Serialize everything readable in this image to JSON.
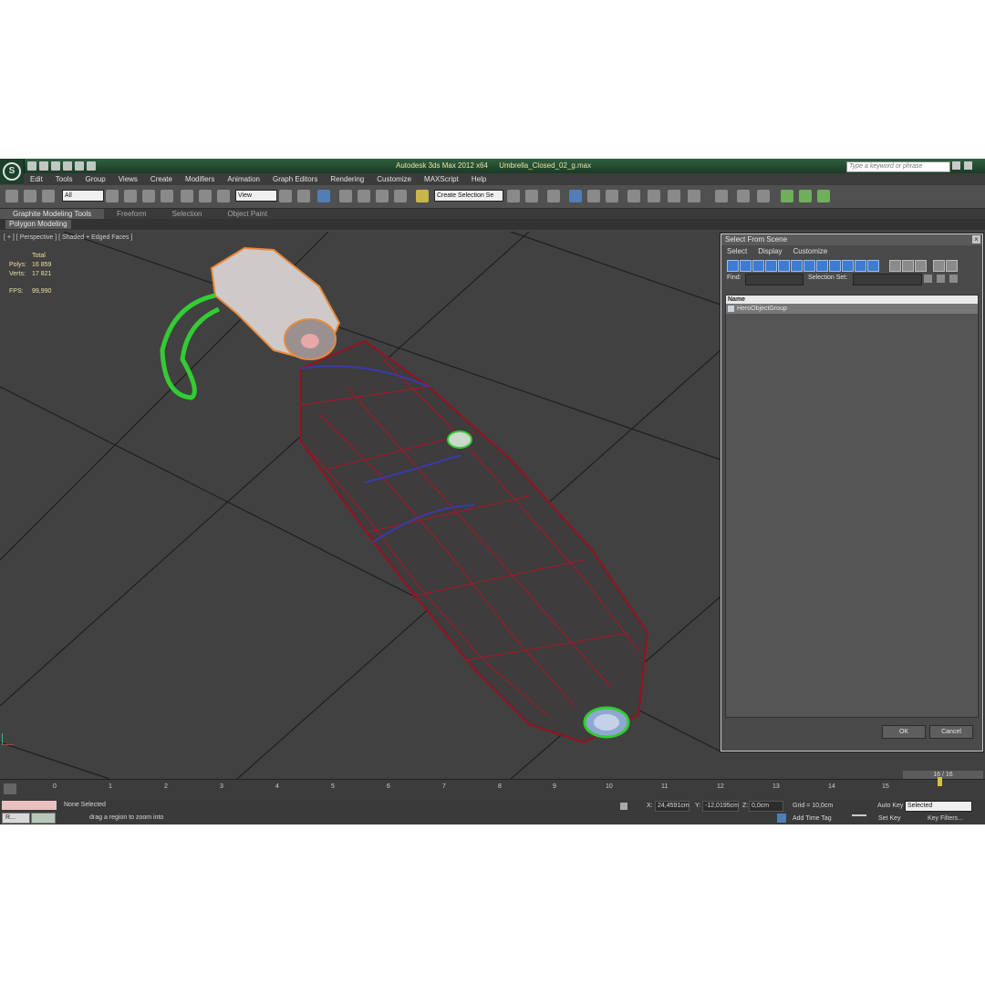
{
  "titlebar": {
    "app_name": "Autodesk 3ds Max  2012 x64",
    "file_name": "Umbrella_Closed_02_g.max",
    "search_placeholder": "Type a keyword or phrase"
  },
  "menu": [
    "Edit",
    "Tools",
    "Group",
    "Views",
    "Create",
    "Modifiers",
    "Animation",
    "Graph Editors",
    "Rendering",
    "Customize",
    "MAXScript",
    "Help"
  ],
  "toolbar": {
    "filter_select": "All",
    "coord_select": "View",
    "selection_set": "Create Selection Se"
  },
  "ribbon": {
    "tabs": [
      "Graphite Modeling Tools",
      "Freeform",
      "Selection",
      "Object Paint"
    ],
    "panel": "Polygon Modeling"
  },
  "viewport": {
    "label": "[ + ] [ Perspective ] [ Shaded + Edged Faces ]",
    "stats": {
      "total_label": "Total",
      "polys_label": "Polys:",
      "polys": "16 859",
      "verts_label": "Verts:",
      "verts": "17 821",
      "fps_label": "FPS:",
      "fps": "99,990"
    }
  },
  "dialog": {
    "title": "Select From Scene",
    "menu": [
      "Select",
      "Display",
      "Customize"
    ],
    "find_label": "Find:",
    "selection_set_label": "Selection Set:",
    "column_header": "Name",
    "items": [
      "HeroObjectGroup"
    ],
    "ok_label": "OK",
    "cancel_label": "Cancel"
  },
  "timeline": {
    "frame_counter": "16 / 16",
    "ticks": [
      "0",
      "1",
      "2",
      "3",
      "4",
      "5",
      "6",
      "7",
      "8",
      "9",
      "10",
      "11",
      "12",
      "13",
      "14",
      "15"
    ]
  },
  "status": {
    "selection": "None Selected",
    "prompt": "drag a region to zoom into",
    "x_label": "X:",
    "x_value": "24,4591cm",
    "y_label": "Y:",
    "y_value": "-12,0195cm",
    "z_label": "Z:",
    "z_value": "0,0cm",
    "grid": "Grid = 10,0cm",
    "add_time_tag": "Add Time Tag",
    "auto_key": "Auto Key",
    "auto_key_select": "Selected",
    "set_key": "Set Key",
    "key_filters": "Key Filters...",
    "taskbar_item": "R..."
  },
  "colors": {
    "viewport_bg": "#414141",
    "wire_red": "#a01020",
    "wire_green": "#33cc33",
    "handle_orange": "#e88a3c",
    "stats_yellow": "#e8e0a0"
  }
}
